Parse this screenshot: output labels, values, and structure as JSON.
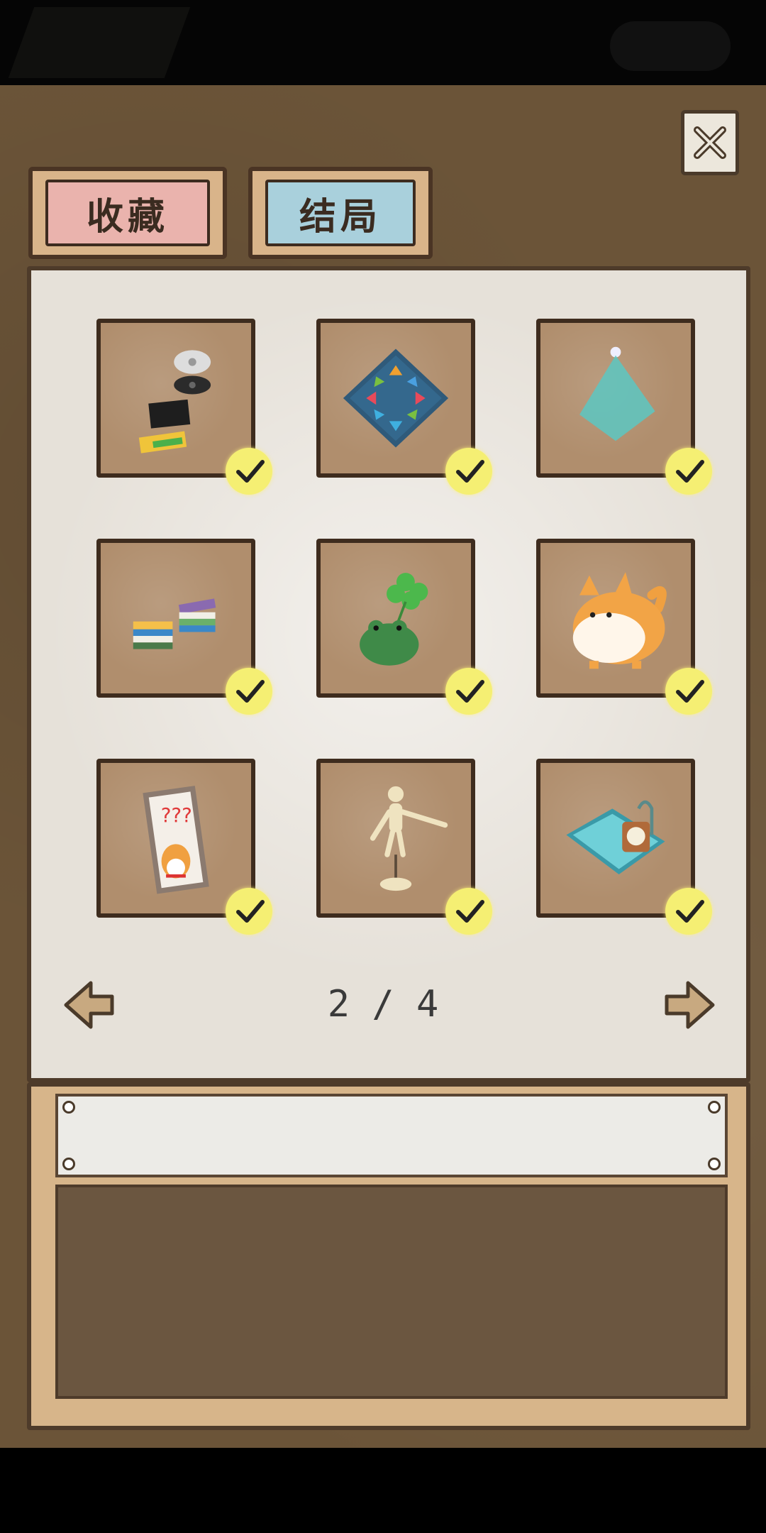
{
  "tabs": {
    "collect_label": "收藏",
    "ending_label": "结局"
  },
  "pagination": {
    "text": "2 / 4"
  },
  "grid": {
    "items": [
      {
        "icon": "cd-and-books-icon",
        "collected": true
      },
      {
        "icon": "arrow-rug-icon",
        "collected": true
      },
      {
        "icon": "spotlight-icon",
        "collected": true
      },
      {
        "icon": "book-stacks-icon",
        "collected": true
      },
      {
        "icon": "frog-clover-icon",
        "collected": true
      },
      {
        "icon": "shiba-dog-icon",
        "collected": true
      },
      {
        "icon": "dog-poster-icon",
        "collected": true
      },
      {
        "icon": "wooden-mannequin-icon",
        "collected": true
      },
      {
        "icon": "aquarium-clock-icon",
        "collected": true
      }
    ]
  },
  "description": {
    "title": "",
    "body": ""
  },
  "colors": {
    "tab_collect": "#eab3ad",
    "tab_ending": "#a9d0dc",
    "check": "#f5ef73",
    "card": "#b08e6d"
  }
}
